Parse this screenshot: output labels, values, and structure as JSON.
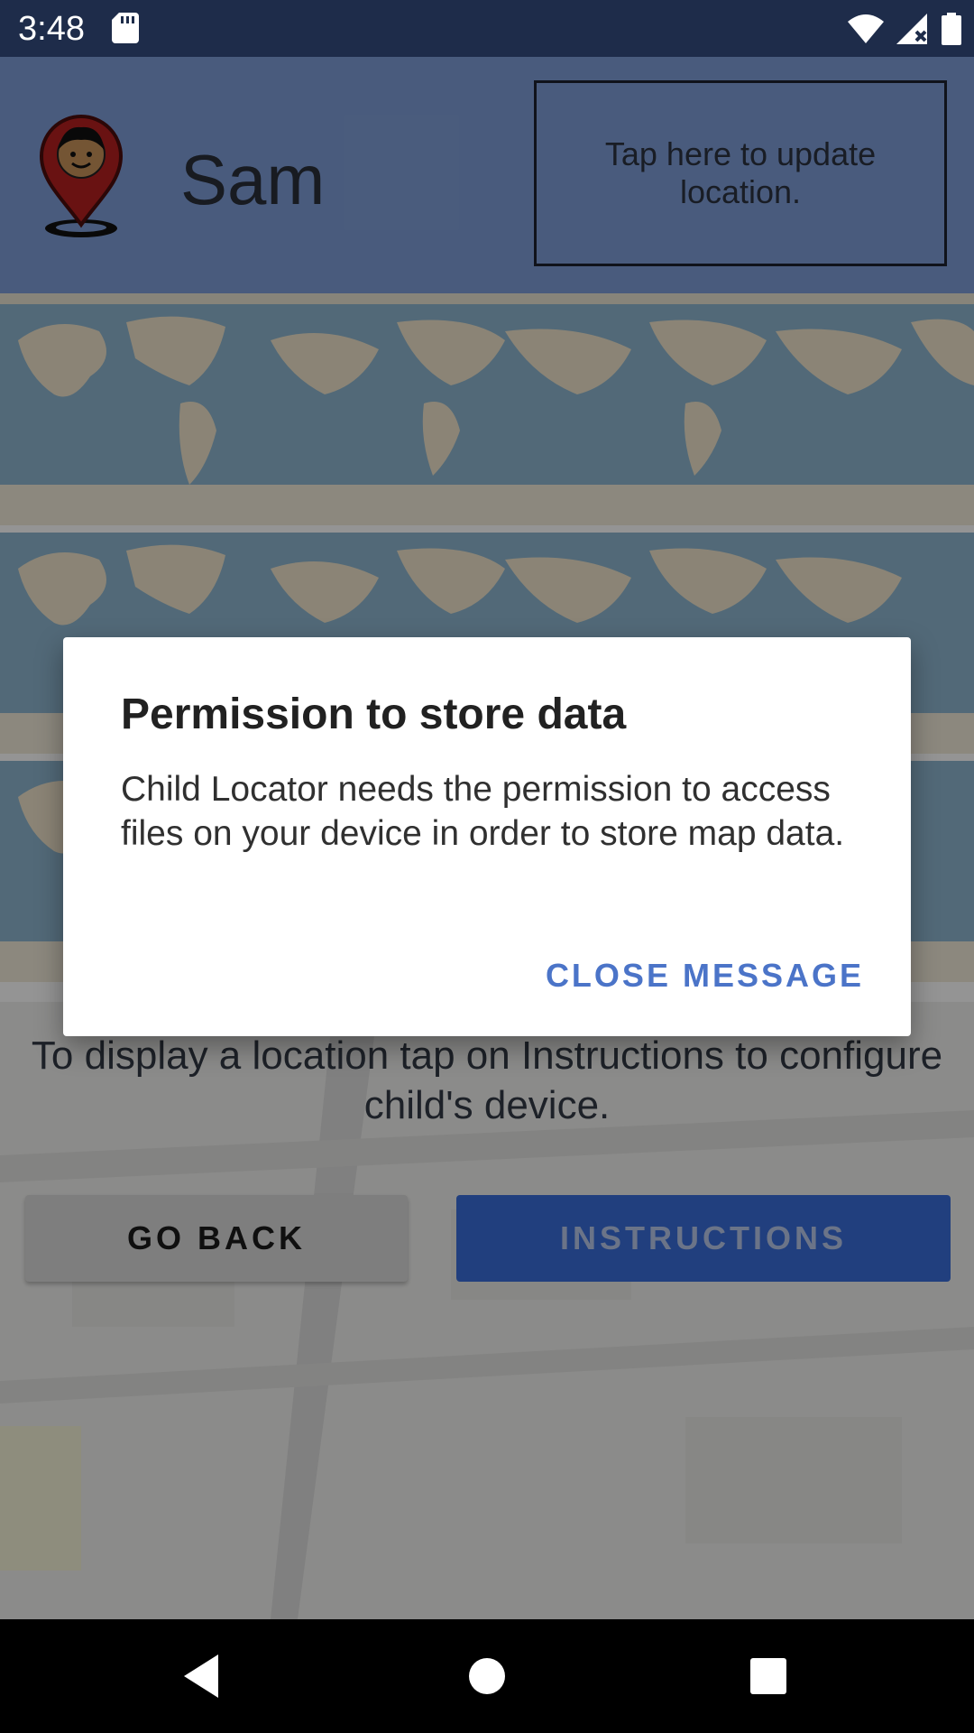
{
  "status_bar": {
    "time": "3:48",
    "icons": [
      "sd-card-icon",
      "wifi-icon",
      "cell-signal-icon",
      "battery-icon"
    ]
  },
  "header": {
    "child_name": "Sam",
    "update_location_label": "Tap here to update location.",
    "avatar_icon": "child-location-pin-icon"
  },
  "main": {
    "info_text": "To display a location tap on Instructions to configure child's device.",
    "go_back_label": "GO BACK",
    "instructions_label": "INSTRUCTIONS"
  },
  "dialog": {
    "title": "Permission to store data",
    "message": "Child Locator needs the permission to access files on your device in order to store map data.",
    "action_label": "CLOSE MESSAGE"
  },
  "nav_bar": {
    "icons": [
      "back-icon",
      "home-icon",
      "recents-icon"
    ]
  },
  "colors": {
    "status_bar": "#1e2c4a",
    "header": "#7f9ed8",
    "primary_button": "#3a6dd9",
    "dialog_accent": "#4b74c8",
    "map_water": "#8db6cf",
    "map_land": "#efe4cc"
  }
}
